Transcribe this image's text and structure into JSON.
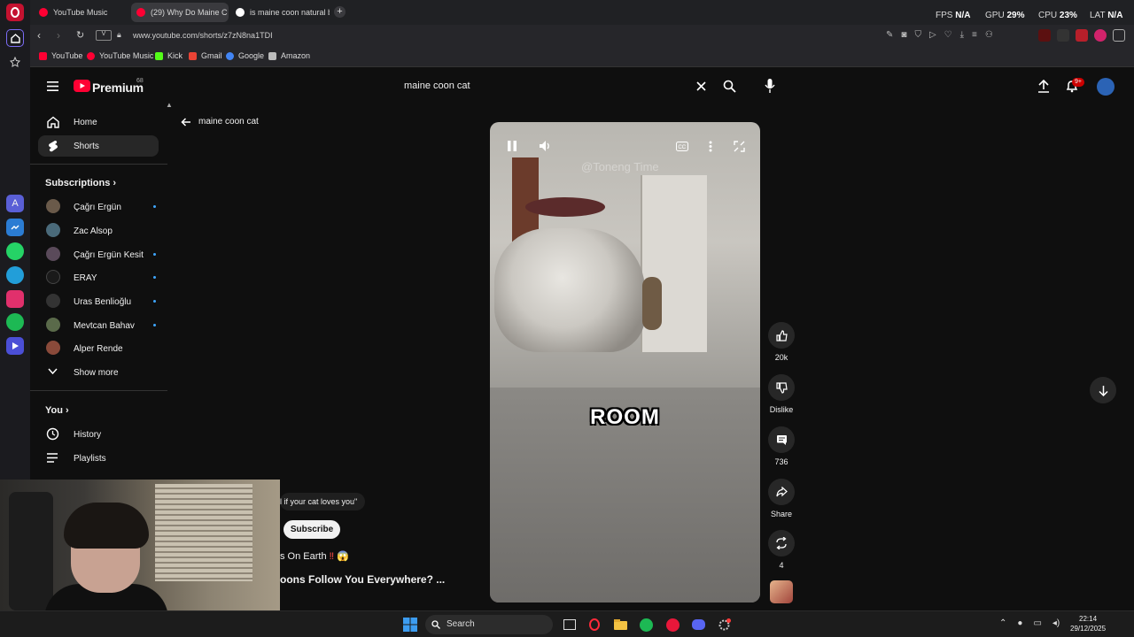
{
  "browser": {
    "tabs": [
      {
        "title": "YouTube Music",
        "favicon_color": "#ff0033"
      },
      {
        "title": "(29) Why Do Maine C",
        "favicon_color": "#ff0033"
      },
      {
        "title": "is maine coon natural bre",
        "favicon_color": "#ffffff"
      }
    ],
    "url": "www.youtube.com/shorts/z7zN8na1TDI",
    "bookmarks": [
      {
        "label": "YouTube",
        "color": "#ff0033"
      },
      {
        "label": "YouTube Music",
        "color": "#ff0033"
      },
      {
        "label": "Kick",
        "color": "#53fc18"
      },
      {
        "label": "Gmail",
        "color": "#ea4335"
      },
      {
        "label": "Google",
        "color": "#4285f4"
      },
      {
        "label": "Amazon",
        "color": "#bbbbbb"
      }
    ],
    "hud": {
      "fps_label": "FPS",
      "fps_value": "N/A",
      "gpu_label": "GPU",
      "gpu_value": "29%",
      "cpu_label": "CPU",
      "cpu_value": "23%",
      "lat_label": "LAT",
      "lat_value": "N/A"
    }
  },
  "youtube": {
    "logo": "Premium",
    "logo_badge": "68",
    "search_value": "maine coon cat",
    "notification_badge": "9+",
    "back_label": "maine coon cat",
    "nav": [
      {
        "label": "Home",
        "icon": "home-icon"
      },
      {
        "label": "Shorts",
        "icon": "shorts-icon"
      }
    ],
    "subscriptions_title": "Subscriptions",
    "subscriptions": [
      {
        "name": "Çağrı Ergün",
        "live": true,
        "color": "#6a5a4a"
      },
      {
        "name": "Zac Alsop",
        "live": false,
        "color": "#4a6a7a"
      },
      {
        "name": "Çağrı Ergün Kesit",
        "live": true,
        "color": "#5a4a5a"
      },
      {
        "name": "ERAY",
        "live": true,
        "color": "#1a1a1a"
      },
      {
        "name": "Uras Benlioğlu",
        "live": true,
        "color": "#333333"
      },
      {
        "name": "Mevtcan Bahav",
        "live": true,
        "color": "#5a6a4a"
      },
      {
        "name": "Alper Rende",
        "live": false,
        "color": "#8a4a3a"
      }
    ],
    "show_more": "Show more",
    "you_title": "You",
    "you_items": [
      {
        "label": "History",
        "icon": "history-icon"
      },
      {
        "label": "Playlists",
        "icon": "playlists-icon"
      }
    ],
    "video": {
      "watermark": "@Toneng Time",
      "caption": "ROOM"
    },
    "actions": {
      "likes": "20k",
      "dislike": "Dislike",
      "comments": "736",
      "share": "Share",
      "remix": "4"
    },
    "info": {
      "comment_fragment": "l if your cat loves you\"",
      "subscribe": "Subscribe",
      "channel_fragment": "s On Earth",
      "title_fragment": "oons Follow You Everywhere? ..."
    }
  },
  "taskbar": {
    "search": "Search",
    "time": "22:14",
    "date": "29/12/2025"
  }
}
